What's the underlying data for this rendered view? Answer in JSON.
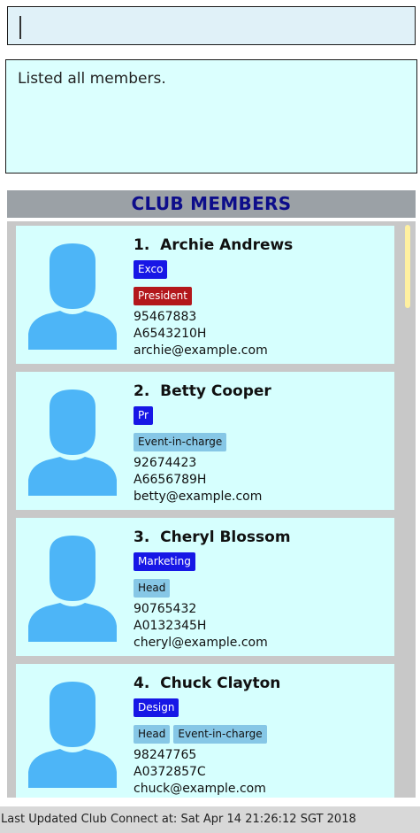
{
  "command": {
    "value": "",
    "placeholder": ""
  },
  "result": {
    "message": "Listed all members."
  },
  "list": {
    "header": "CLUB MEMBERS",
    "members": [
      {
        "index": "1.",
        "name": "Archie Andrews",
        "tags_row1": [
          "Exco"
        ],
        "tags_row2": [
          "President"
        ],
        "phone": "95467883",
        "id": "A6543210H",
        "email": "archie@example.com"
      },
      {
        "index": "2.",
        "name": "Betty Cooper",
        "tags_row1": [
          "Pr"
        ],
        "tags_row2": [
          "Event-in-charge"
        ],
        "phone": "92674423",
        "id": "A6656789H",
        "email": "betty@example.com"
      },
      {
        "index": "3.",
        "name": "Cheryl Blossom",
        "tags_row1": [
          "Marketing"
        ],
        "tags_row2": [
          "Head"
        ],
        "phone": "90765432",
        "id": "A0132345H",
        "email": "cheryl@example.com"
      },
      {
        "index": "4.",
        "name": "Chuck Clayton",
        "tags_row1": [
          "Design"
        ],
        "tags_row2": [
          "Head",
          "Event-in-charge"
        ],
        "phone": "98247765",
        "id": "A0372857C",
        "email": "chuck@example.com"
      }
    ]
  },
  "status": {
    "text": "Last Updated Club Connect at: Sat Apr 14 21:26:12 SGT 2018"
  },
  "colors": {
    "group_tag": "#1717e6",
    "president_tag": "#b3181c",
    "role_tag": "#86c7e6",
    "avatar": "#4db5f7",
    "card_bg": "#d6fffe"
  },
  "icons": {
    "avatar": "user-avatar-icon"
  }
}
